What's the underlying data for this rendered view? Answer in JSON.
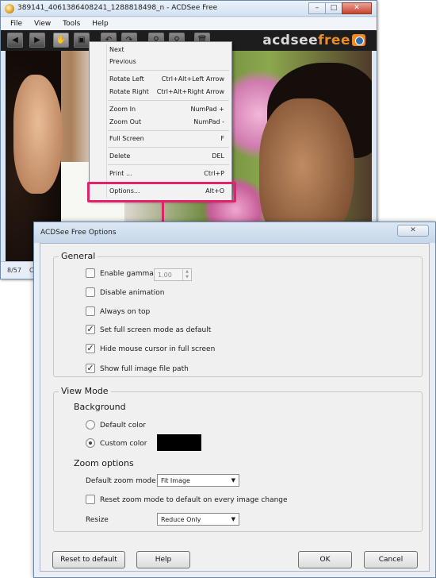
{
  "main_window": {
    "title": "389141_4061386408241_1288818498_n - ACDSee Free",
    "controls": {
      "minimize": "–",
      "maximize": "□",
      "close": "✕"
    },
    "menu": [
      "File",
      "View",
      "Tools",
      "Help"
    ],
    "toolbar_icons": [
      "arrow-left-icon",
      "arrow-right-icon",
      "hand-icon",
      "crop-icon",
      "rotate-left-icon",
      "rotate-right-icon",
      "zoom-in-icon",
      "zoom-out-icon",
      "delete-icon"
    ],
    "logo": {
      "part1": "acdsee",
      "part2": "free"
    },
    "status": {
      "counter": "8/57",
      "extra": "C"
    }
  },
  "context_menu": {
    "items": [
      {
        "label": "Next",
        "shortcut": ""
      },
      {
        "label": "Previous",
        "shortcut": ""
      },
      {
        "label": "Rotate Left",
        "shortcut": "Ctrl+Alt+Left Arrow"
      },
      {
        "label": "Rotate Right",
        "shortcut": "Ctrl+Alt+Right Arrow"
      },
      {
        "label": "Zoom In",
        "shortcut": "NumPad +"
      },
      {
        "label": "Zoom Out",
        "shortcut": "NumPad -"
      },
      {
        "label": "Full Screen",
        "shortcut": "F"
      },
      {
        "label": "Delete",
        "shortcut": "DEL"
      },
      {
        "label": "Print ...",
        "shortcut": "Ctrl+P"
      },
      {
        "label": "Options...",
        "shortcut": "Alt+O"
      }
    ],
    "highlight_color": "#e0236b"
  },
  "dialog": {
    "title": "ACDSee Free Options",
    "close_glyph": "✕",
    "general": {
      "legend": "General",
      "options": [
        {
          "label": "Enable gamma correction",
          "checked": false
        },
        {
          "label": "Disable animation",
          "checked": false
        },
        {
          "label": "Always on top",
          "checked": false
        },
        {
          "label": "Set full screen mode as default",
          "checked": true
        },
        {
          "label": "Hide mouse cursor in full screen",
          "checked": true
        },
        {
          "label": "Show full image file path",
          "checked": true
        }
      ],
      "gamma_value": "1.00"
    },
    "view_mode": {
      "legend": "View Mode",
      "background_heading": "Background",
      "default_color_label": "Default color",
      "custom_color_label": "Custom color",
      "selected_background": "custom",
      "custom_color": "#000000",
      "zoom_heading": "Zoom options",
      "default_zoom_label": "Default zoom mode",
      "default_zoom_value": "Fit Image",
      "reset_zoom_label": "Reset zoom mode to default on every image change",
      "reset_zoom_checked": false,
      "resize_label": "Resize",
      "resize_value": "Reduce Only"
    },
    "buttons": {
      "reset": "Reset to default",
      "help": "Help",
      "ok": "OK",
      "cancel": "Cancel"
    }
  }
}
